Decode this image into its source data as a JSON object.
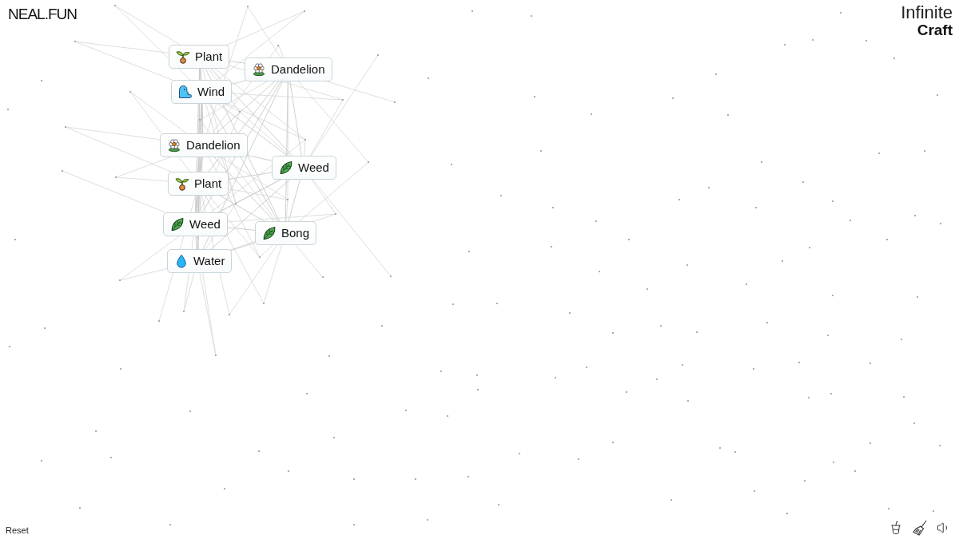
{
  "logo": {
    "text": "NEAL.FUN"
  },
  "title": {
    "line_1": "Infinite",
    "line_2": "Craft"
  },
  "elements": [
    {
      "label": "Plant",
      "kind": "sprout"
    },
    {
      "label": "Dandelion",
      "kind": "flower"
    },
    {
      "label": "Wind",
      "kind": "wind"
    },
    {
      "label": "Dandelion",
      "kind": "flower"
    },
    {
      "label": "Weed",
      "kind": "leaf"
    },
    {
      "label": "Plant",
      "kind": "sprout"
    },
    {
      "label": "Weed",
      "kind": "leaf"
    },
    {
      "label": "Bong",
      "kind": "leaf"
    },
    {
      "label": "Water",
      "kind": "drop"
    }
  ],
  "reset": "Reset"
}
